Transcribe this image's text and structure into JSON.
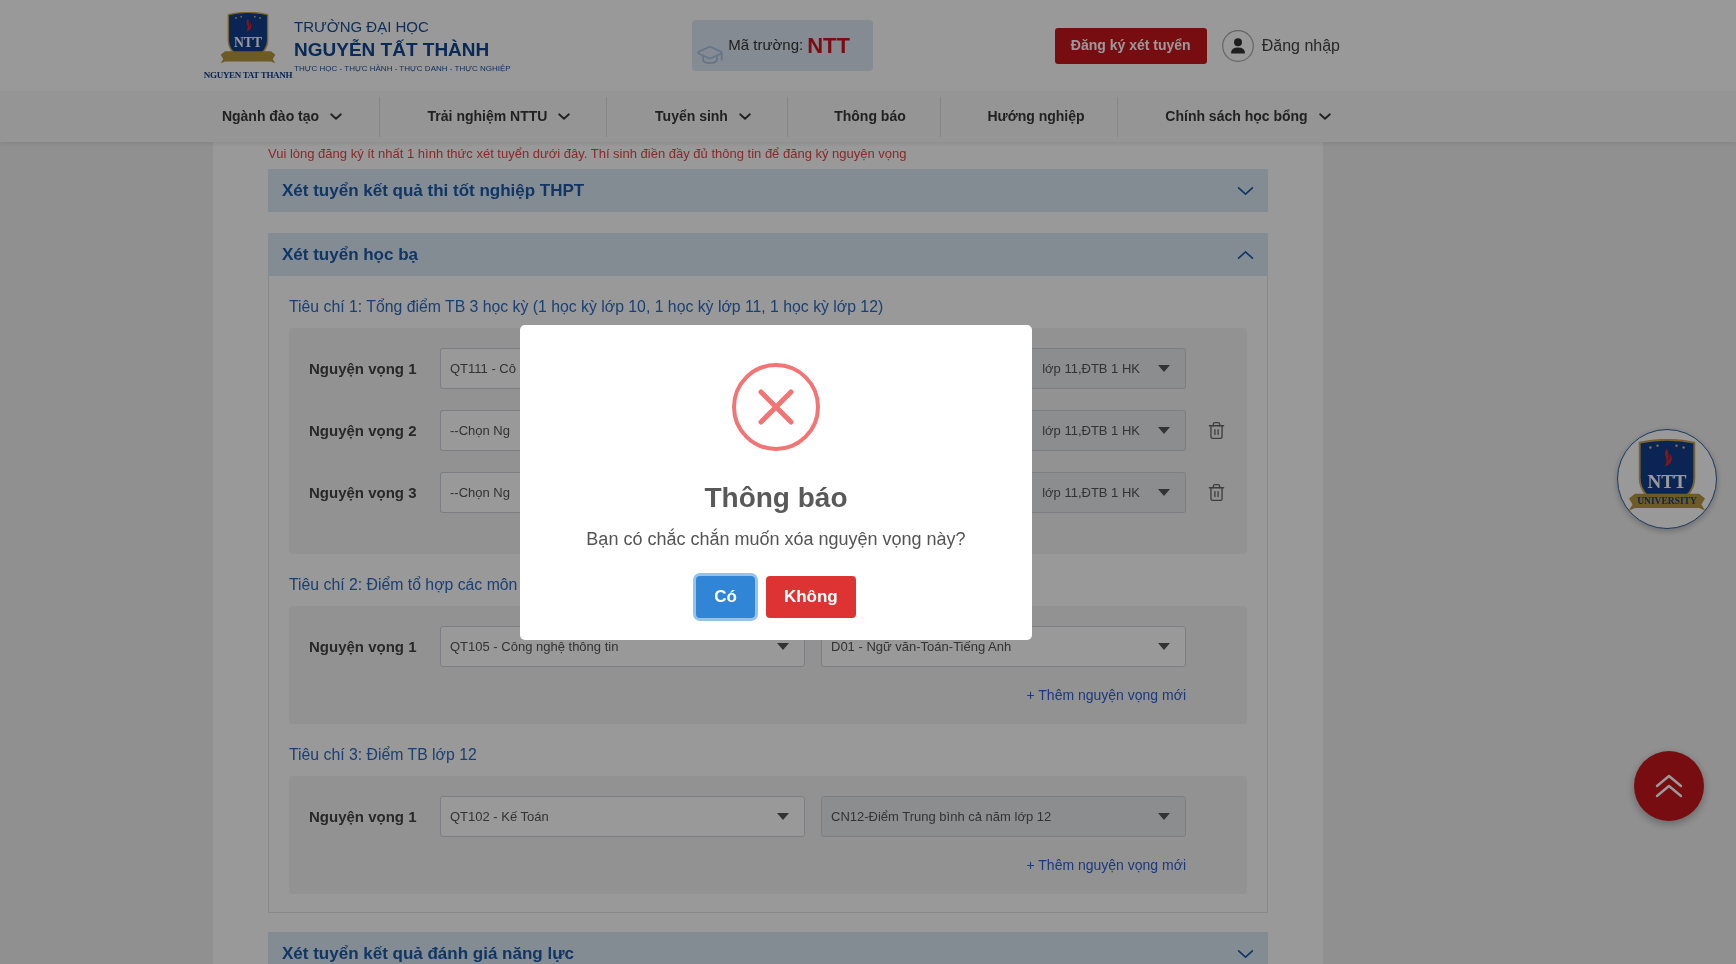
{
  "header": {
    "logo": {
      "monogram": "NTT",
      "caption": "NGUYEN TAT THANH"
    },
    "school_type": "TRƯỜNG ĐẠI HỌC",
    "school_name": "NGUYỄN TẤT THÀNH",
    "motto": "THỰC HỌC - THỰC HÀNH - THỰC DANH - THỰC NGHIỆP",
    "code_label": "Mã trường:",
    "code": "NTT",
    "register_button": "Đăng ký xét tuyển",
    "login": "Đăng nhập"
  },
  "nav": [
    {
      "label": "Ngành đào tạo",
      "dropdown": true
    },
    {
      "label": "Trải nghiệm NTTU",
      "dropdown": true
    },
    {
      "label": "Tuyển sinh",
      "dropdown": true
    },
    {
      "label": "Thông báo",
      "dropdown": false
    },
    {
      "label": "Hướng nghiệp",
      "dropdown": false
    },
    {
      "label": "Chính sách học bổng",
      "dropdown": true
    }
  ],
  "notice": "Vui lòng đăng ký ít nhất 1 hình thức xét tuyển dưới đây. Thí sinh điền đầy đủ thông tin để đăng ký nguyện vọng",
  "sections": [
    {
      "title": "Xét tuyển kết quả thi tốt nghiệp THPT",
      "expanded": false
    },
    {
      "title": "Xét tuyển học bạ",
      "expanded": true,
      "criteria": [
        {
          "title": "Tiêu chí 1: Tổng điểm TB 3 học kỳ (1 học kỳ lớp 10, 1 học kỳ lớp 11, 1 học kỳ lớp 12)",
          "choices": [
            {
              "label": "Nguyện vọng 1",
              "deletable": false,
              "fields": [
                {
                  "kind": "clipped",
                  "value": "QT111 - Cô",
                  "disabled": false
                },
                {
                  "kind": "tail",
                  "value": "lớp 11,ĐTB 1 HK",
                  "disabled": true
                }
              ]
            },
            {
              "label": "Nguyện vọng 2",
              "deletable": true,
              "fields": [
                {
                  "kind": "clipped",
                  "value": "--Chọn Ng",
                  "disabled": false
                },
                {
                  "kind": "tail",
                  "value": "lớp 11,ĐTB 1 HK",
                  "disabled": true
                }
              ]
            },
            {
              "label": "Nguyện vọng 3",
              "deletable": true,
              "fields": [
                {
                  "kind": "clipped",
                  "value": "--Chọn Ng",
                  "disabled": false
                },
                {
                  "kind": "tail",
                  "value": "lớp 11,ĐTB 1 HK",
                  "disabled": true
                }
              ]
            }
          ]
        },
        {
          "title": "Tiêu chí 2: Điểm tổ hợp các môn",
          "choices": [
            {
              "label": "Nguyện vọng 1",
              "deletable": false,
              "fields": [
                {
                  "kind": "select",
                  "value": "QT105 - Công nghệ thông tin",
                  "disabled": false
                },
                {
                  "kind": "select",
                  "value": "D01 - Ngữ văn-Toán-Tiếng Anh",
                  "disabled": false
                }
              ]
            }
          ],
          "add_link": "+ Thêm nguyện vọng mới"
        },
        {
          "title": "Tiêu chí 3: Điểm TB lớp 12",
          "choices": [
            {
              "label": "Nguyện vọng 1",
              "deletable": false,
              "fields": [
                {
                  "kind": "select",
                  "value": "QT102 - Kế Toán",
                  "disabled": false
                },
                {
                  "kind": "select",
                  "value": "CN12-Điểm Trung bình cả năm lớp 12",
                  "disabled": true
                }
              ]
            }
          ],
          "add_link": "+ Thêm nguyện vọng mới"
        }
      ]
    },
    {
      "title": "Xét tuyển kết quả đánh giá năng lực",
      "expanded": false
    }
  ],
  "side_logo": {
    "monogram": "NTT",
    "ribbon": "UNIVERSITY"
  },
  "dialog": {
    "title": "Thông báo",
    "message": "Bạn có chắc chắn muốn xóa nguyện vọng này?",
    "buttons": [
      {
        "label": "Có",
        "kind": "confirm",
        "focused": true
      },
      {
        "label": "Không",
        "kind": "cancel",
        "focused": false
      }
    ]
  }
}
